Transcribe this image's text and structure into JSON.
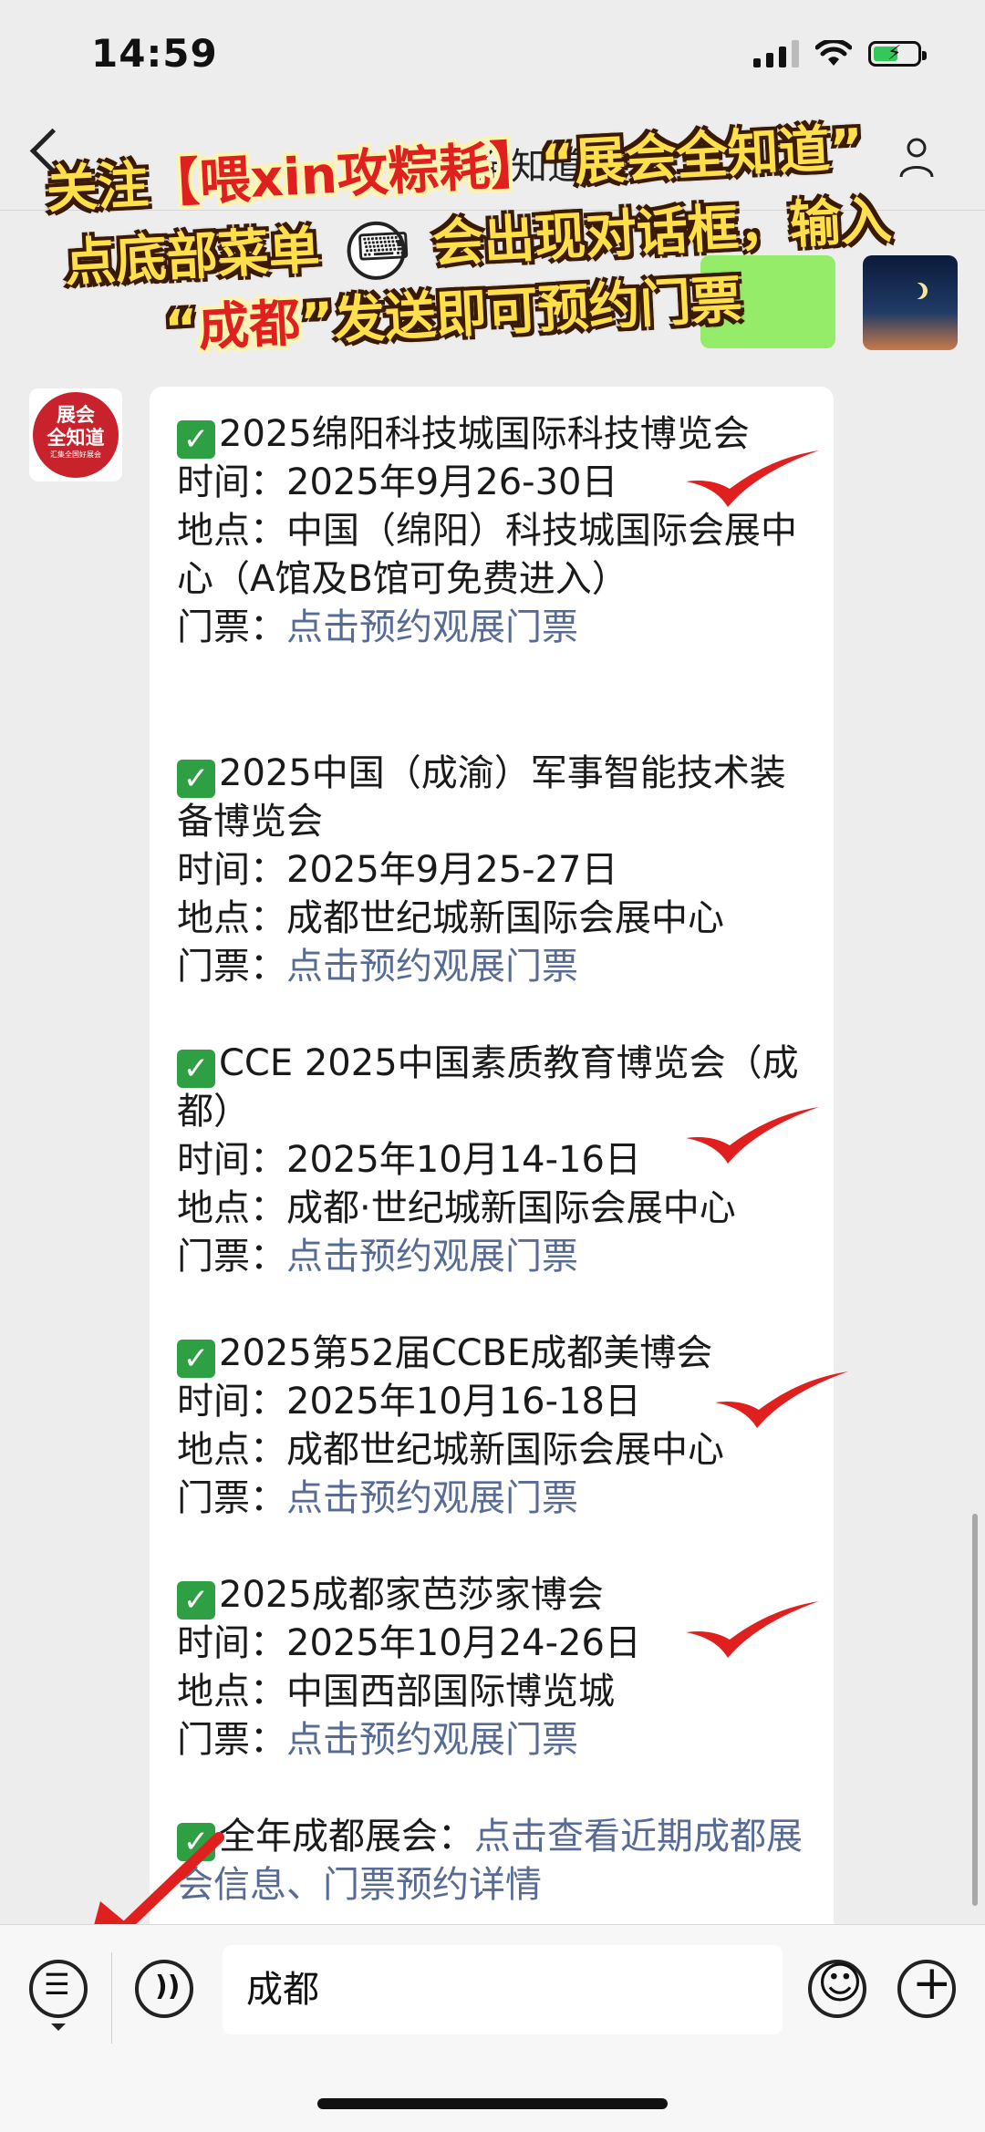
{
  "status": {
    "time": "14:59"
  },
  "nav": {
    "title": "展会全知道"
  },
  "banner": {
    "line1_a": "关注",
    "line1_b": "【喂xin攻粽耗】",
    "line1_c": "“展会全知道”",
    "line2_a": "点底部菜单",
    "line2_b": "会出现对话框，输入",
    "line3_a": "“",
    "line3_b": "成都",
    "line3_c": "”发送即可预约门票"
  },
  "avatar": {
    "line1": "展会",
    "line2": "全知道",
    "sub": "汇集全国好展会"
  },
  "events": [
    {
      "title": "2025绵阳科技城国际科技博览会",
      "time": "时间：2025年9月26-30日",
      "place": "地点：中国（绵阳）科技城国际会展中心（A馆及B馆可免费进入）",
      "ticket_label": "门票：",
      "ticket_link": "点击预约观展门票"
    },
    {
      "title": "2025中国（成渝）军事智能技术装备博览会",
      "time": "时间：2025年9月25-27日",
      "place": "地点：成都世纪城新国际会展中心",
      "ticket_label": "门票：",
      "ticket_link": "点击预约观展门票"
    },
    {
      "title": "CCE 2025中国素质教育博览会（成都）",
      "time": "时间：2025年10月14-16日",
      "place": "地点：成都·世纪城新国际会展中心",
      "ticket_label": "门票：",
      "ticket_link": "点击预约观展门票"
    },
    {
      "title": "2025第52届CCBE成都美博会",
      "time": "时间：2025年10月16-18日",
      "place": "地点：成都世纪城新国际会展中心",
      "ticket_label": "门票：",
      "ticket_link": "点击预约观展门票"
    },
    {
      "title": "2025成都家芭莎家博会",
      "time": "时间：2025年10月24-26日",
      "place": "地点：中国西部国际博览城",
      "ticket_label": "门票：",
      "ticket_link": "点击预约观展门票"
    }
  ],
  "footer_item": {
    "label": "全年成都展会：",
    "link": "点击查看近期成都展会信息、门票预约详情"
  },
  "input": {
    "value": "成都"
  },
  "colors": {
    "link": "#576b95",
    "check": "#2ea043",
    "tick": "#e0201e",
    "bubble": "#ffffff",
    "background": "#ededed"
  }
}
